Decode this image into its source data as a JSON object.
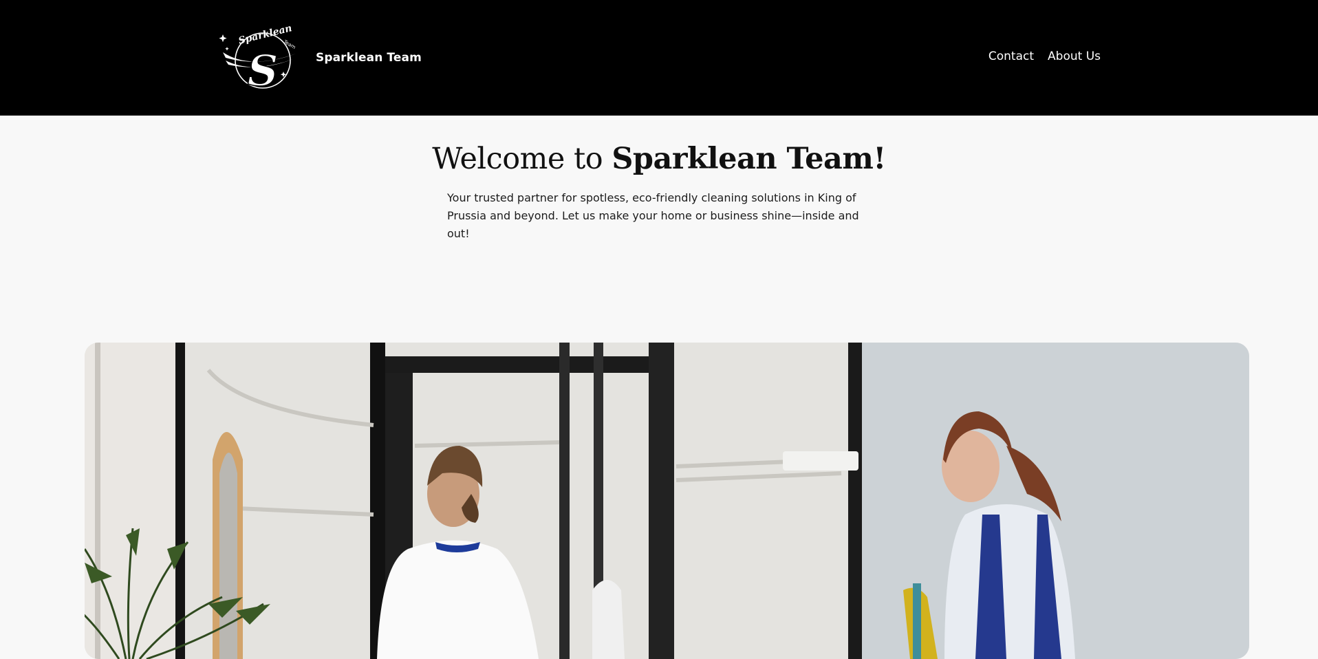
{
  "header": {
    "brand_name": "Sparklean Team",
    "logo_text": "Sparklean",
    "logo_subtext": "Team",
    "logo_letter": "S",
    "nav": [
      {
        "label": "Contact"
      },
      {
        "label": "About Us"
      }
    ]
  },
  "hero": {
    "title_prefix": "Welcome to",
    "title_brand": "Sparklean Team!",
    "description": "Your trusted partner for spotless, eco-friendly cleaning solutions in King of Prussia and beyond. Let us make your home or business shine—inside and out!"
  },
  "colors": {
    "header_bg": "#000000",
    "page_bg": "#f8f8f8",
    "text": "#111111"
  }
}
